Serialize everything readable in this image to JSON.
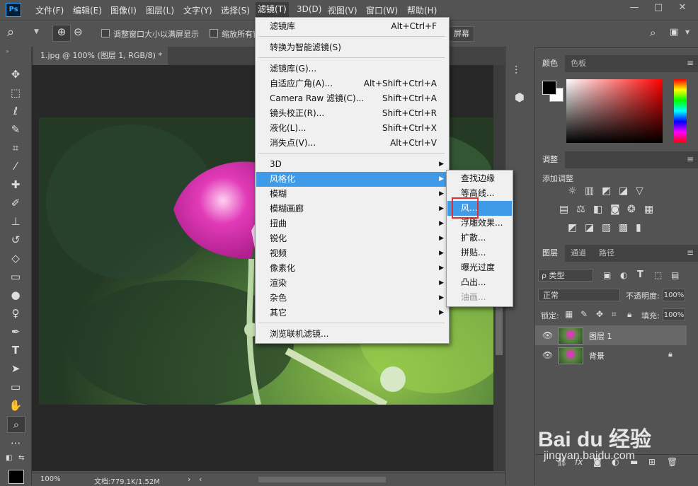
{
  "app": {
    "logo": "Ps"
  },
  "menubar": {
    "items": [
      "文件(F)",
      "编辑(E)",
      "图像(I)",
      "图层(L)",
      "文字(Y)",
      "选择(S)",
      "滤镜(T)",
      "3D(D)",
      "视图(V)",
      "窗口(W)",
      "帮助(H)"
    ],
    "active": "滤镜(T)",
    "window_buttons": {
      "minimize": "—",
      "maximize": "□",
      "close": "✕"
    }
  },
  "options": {
    "resize_windows_label": "调整窗口大小以满屏显示",
    "zoom_all_label": "缩放所有窗",
    "fill_screen_label": "屏幕"
  },
  "document": {
    "tab_title": "1.jpg @ 100% (图层 1, RGB/8) *",
    "tab_close": "×",
    "zoom": "100%",
    "doc_info": "文档:779.1K/1.52M"
  },
  "filter_menu": {
    "items": [
      {
        "label": "滤镜库",
        "shortcut": "Alt+Ctrl+F"
      },
      {
        "label": "转换为智能滤镜(S)",
        "shortcut": ""
      },
      {
        "label": "滤镜库(G)...",
        "shortcut": ""
      },
      {
        "label": "自适应广角(A)...",
        "shortcut": "Alt+Shift+Ctrl+A"
      },
      {
        "label": "Camera Raw 滤镜(C)...",
        "shortcut": "Shift+Ctrl+A"
      },
      {
        "label": "镜头校正(R)...",
        "shortcut": "Shift+Ctrl+R"
      },
      {
        "label": "液化(L)...",
        "shortcut": "Shift+Ctrl+X"
      },
      {
        "label": "消失点(V)...",
        "shortcut": "Alt+Ctrl+V"
      },
      {
        "label": "3D",
        "shortcut": ""
      },
      {
        "label": "风格化",
        "shortcut": ""
      },
      {
        "label": "模糊",
        "shortcut": ""
      },
      {
        "label": "模糊画廊",
        "shortcut": ""
      },
      {
        "label": "扭曲",
        "shortcut": ""
      },
      {
        "label": "锐化",
        "shortcut": ""
      },
      {
        "label": "视频",
        "shortcut": ""
      },
      {
        "label": "像素化",
        "shortcut": ""
      },
      {
        "label": "渲染",
        "shortcut": ""
      },
      {
        "label": "杂色",
        "shortcut": ""
      },
      {
        "label": "其它",
        "shortcut": ""
      },
      {
        "label": "浏览联机滤镜...",
        "shortcut": ""
      }
    ],
    "submenu_arrow": "▶"
  },
  "stylize_submenu": {
    "items": [
      "查找边缘",
      "等高线...",
      "风...",
      "浮雕效果...",
      "扩散...",
      "拼贴...",
      "曝光过度",
      "凸出...",
      "油画..."
    ]
  },
  "color_panel": {
    "tabs": [
      "颜色",
      "色板"
    ],
    "fg": "#000000",
    "bg": "#ffffff"
  },
  "adjust_panel": {
    "tabs": [
      "调整"
    ],
    "add_label": "添加调整"
  },
  "layers_panel": {
    "tabs": [
      "图层",
      "通道",
      "路径"
    ],
    "filter_kind": "ρ 类型",
    "blend_mode": "正常",
    "opacity_label": "不透明度:",
    "opacity_value": "100%",
    "lock_label": "锁定:",
    "fill_label": "填充:",
    "fill_value": "100%",
    "layers": [
      {
        "name": "图层 1",
        "selected": true
      },
      {
        "name": "背景",
        "selected": false
      }
    ]
  },
  "watermark": {
    "text": "Bai du 经验",
    "url": "jingyan.baidu.com"
  },
  "colors": {
    "accent": "#3f9be8",
    "highlight_box": "#e03030",
    "menu_bg": "#f0f0f0"
  }
}
